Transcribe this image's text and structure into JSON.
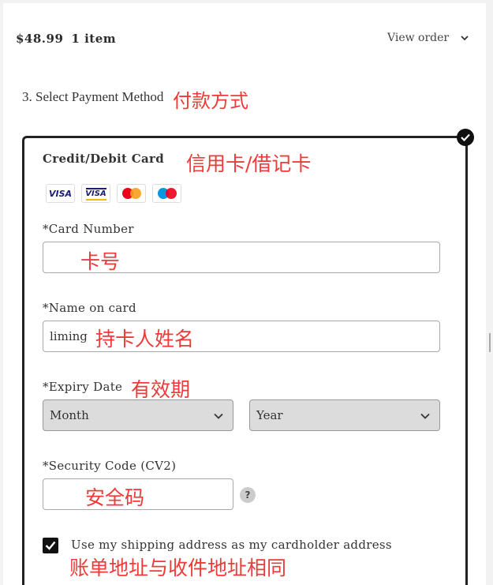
{
  "order_summary": {
    "total": "$48.99",
    "items": "1 item",
    "view_order_label": "View order"
  },
  "payment": {
    "step_title": "3. Select Payment Method",
    "step_title_note": "付款方式",
    "method_title": "Credit/Debit Card",
    "method_title_note": "信用卡/借记卡",
    "card_logos": [
      {
        "name": "visa",
        "label": "VISA"
      },
      {
        "name": "visa-electron",
        "label": "VISA"
      },
      {
        "name": "mastercard",
        "label": ""
      },
      {
        "name": "maestro",
        "label": ""
      }
    ],
    "card_number": {
      "label": "*Card Number",
      "value": "",
      "note": "卡号"
    },
    "name_on_card": {
      "label": "*Name on card",
      "value": "liming",
      "note": "持卡人姓名"
    },
    "expiry": {
      "label": "*Expiry Date",
      "note": "有效期",
      "month_value": "Month",
      "year_value": "Year"
    },
    "security_code": {
      "label": "*Security Code (CV2)",
      "value": "",
      "note": "安全码",
      "help_label": "?"
    },
    "same_address": {
      "checked": true,
      "label": "Use my shipping address as my cardholder address",
      "note": "账单地址与收件地址相同"
    }
  },
  "colors": {
    "annotation": "#f03a3a",
    "visa_blue": "#1a1f71",
    "visa_gold": "#f7b600",
    "mc_red": "#eb001b",
    "mc_yellow": "#f79e1b",
    "maestro_blue": "#0099df",
    "selected_border": "#222222"
  }
}
